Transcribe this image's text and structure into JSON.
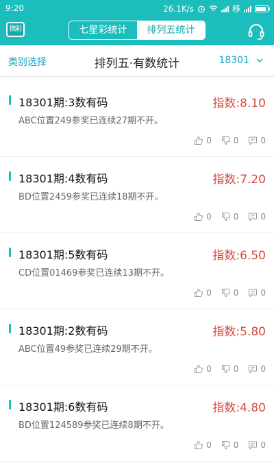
{
  "status_bar": {
    "time": "9:20",
    "speed": "26.1K/s",
    "carrier": "移"
  },
  "header": {
    "logo_text": "微彩",
    "tabs": [
      {
        "label": "七星彩统计",
        "active": false
      },
      {
        "label": "排列五统计",
        "active": true
      }
    ]
  },
  "subbar": {
    "category_label": "类别选择",
    "title": "排列五·有数统计",
    "issue": "18301"
  },
  "records": [
    {
      "title": "18301期:3数有码",
      "index": "指数:8.10",
      "desc": "ABC位置249参奖已连续27期不开。",
      "likes": "0",
      "dislikes": "0",
      "comments": "0"
    },
    {
      "title": "18301期:4数有码",
      "index": "指数:7.20",
      "desc": "BD位置2459参奖已连续18期不开。",
      "likes": "0",
      "dislikes": "0",
      "comments": "0"
    },
    {
      "title": "18301期:5数有码",
      "index": "指数:6.50",
      "desc": "CD位置01469参奖已连续13期不开。",
      "likes": "0",
      "dislikes": "0",
      "comments": "0"
    },
    {
      "title": "18301期:2数有码",
      "index": "指数:5.80",
      "desc": "ABC位置49参奖已连续29期不开。",
      "likes": "0",
      "dislikes": "0",
      "comments": "0"
    },
    {
      "title": "18301期:6数有码",
      "index": "指数:4.80",
      "desc": "BD位置124589参奖已连续8期不开。",
      "likes": "0",
      "dislikes": "0",
      "comments": "0"
    }
  ],
  "colors": {
    "accent": "#1bbdbd",
    "index_red": "#d9493e",
    "link_blue": "#1aa7c4"
  }
}
